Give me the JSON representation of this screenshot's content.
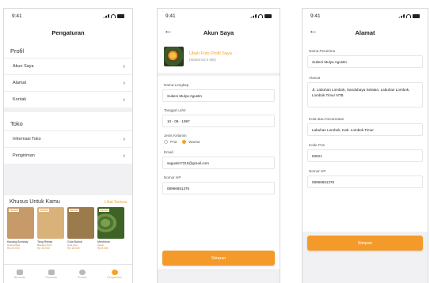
{
  "status_time": "9:41",
  "screen1": {
    "title": "Pengaturan",
    "profile_section": "Profil",
    "profile_items": [
      "Akun Saya",
      "Alamat",
      "Kontak"
    ],
    "store_section": "Toko",
    "store_items": [
      "Informasi Toko",
      "Pengiriman"
    ],
    "promo": {
      "title": "Khusus Untuk Kamu",
      "see_all": "Lihat Semua",
      "products": [
        {
          "name": "Kacang Bombay",
          "sub": "Aneka Rasa",
          "price": "Rp 25.000",
          "tag": "PROMO",
          "color": "#c79a6a"
        },
        {
          "name": "Teng Rebas",
          "sub": "Bawang Putih",
          "price": "Rp 15.000",
          "tag": "PROMO",
          "color": "#d9b27a"
        },
        {
          "name": "Gula Bubuk",
          "sub": "Gula Aren",
          "price": "Rp 18.000",
          "tag": "PROMO",
          "color": "#9b7a4b"
        },
        {
          "name": "Mentimun",
          "sub": "Segar",
          "price": "Rp 8.000",
          "tag": "PROMO",
          "color": "#5b7f3a"
        }
      ]
    },
    "nav": [
      {
        "label": "Beranda",
        "active": false
      },
      {
        "label": "Pesanan",
        "active": false
      },
      {
        "label": "Produk",
        "active": false
      },
      {
        "label": "Pengaturan",
        "active": true
      }
    ]
  },
  "screen2": {
    "title": "Akun Saya",
    "photo_link": "Ubah Foto Profil Saya",
    "photo_hint": "(Maksimal 5 MB)",
    "full_name_label": "Nama Lengkap",
    "full_name_value": "Sukeni Mulya Agustin",
    "dob_label": "Tanggal Lahir",
    "dob_value": "10 - 08 - 1997",
    "gender_label": "Jenis Kelamin",
    "gender_options": [
      "Pria",
      "Wanita"
    ],
    "gender_selected": "Wanita",
    "email_label": "Email",
    "email_value": "sagustin7310@gmail.com",
    "phone_label": "Nomor HP",
    "phone_value": "08966651376",
    "save_label": "Simpan"
  },
  "screen3": {
    "title": "Alamat",
    "recipient_label": "Nama Penerima",
    "recipient_value": "Sukeni Mulya Agustin",
    "address_label": "Alamat",
    "address_value": "Jl. Labuhan Lombok, Sandubaya Selatan, Labuhan Lombok, Lombok Timur NTB",
    "city_label": "Kota atau Kecamatan",
    "city_value": "Labuhan Lombok, Kab. Lombok Timur",
    "zip_label": "Kode Pos",
    "zip_value": "83621",
    "phone_label": "Nomor HP",
    "phone_value": "08966651376",
    "save_label": "Simpan"
  },
  "colors": {
    "accent": "#f39a2b",
    "background": "#f1f1f3"
  },
  "icons": {
    "back": "arrow-left-icon",
    "chevron": "chevron-right-icon"
  }
}
